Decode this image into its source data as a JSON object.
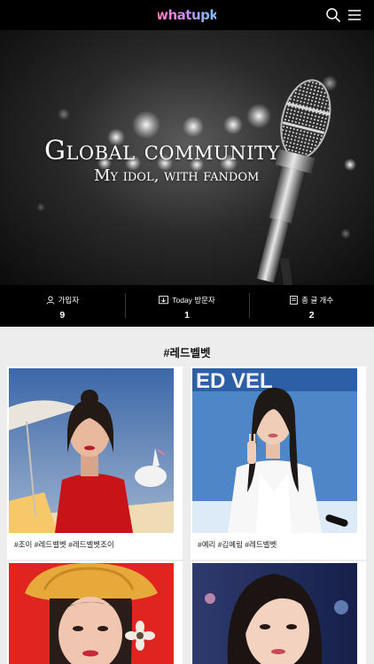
{
  "header": {
    "logo_text": "whatupk",
    "icons": [
      "search-icon",
      "menu-icon"
    ]
  },
  "hero": {
    "title": "Global community",
    "subtitle": "My idol, with fandom"
  },
  "stats": [
    {
      "label": "가입자",
      "value": "9",
      "icon": "user-icon"
    },
    {
      "label": "Today 방문자",
      "value": "1",
      "icon": "visitor-icon"
    },
    {
      "label": "총 글 개수",
      "value": "2",
      "icon": "document-icon"
    }
  ],
  "section": {
    "title": "#레드벨벳"
  },
  "cards": [
    {
      "tags": "#조이 #레드벨벳 #레드벨벳조이"
    },
    {
      "tags": "#예리 #김예림 #레드벨벳"
    },
    {
      "tags": ""
    },
    {
      "tags": ""
    }
  ],
  "colors": {
    "header_bg": "#000000",
    "page_bg": "#ededed",
    "card_bg": "#ffffff"
  }
}
